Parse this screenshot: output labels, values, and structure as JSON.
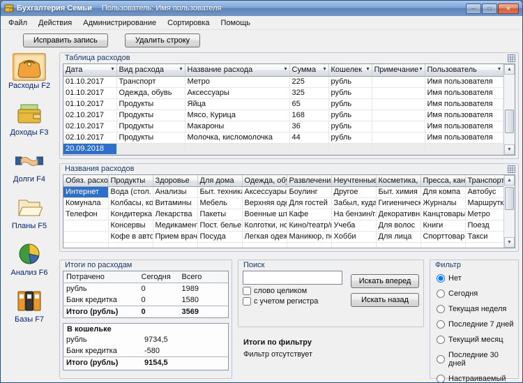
{
  "window": {
    "title": "Бухгалтерия Семьи",
    "user": "Пользователь: Имя пользователя",
    "controls": {
      "minimize": "─",
      "maximize": "□",
      "close": "✕"
    }
  },
  "menu": {
    "items": [
      {
        "label": "Файл"
      },
      {
        "label": "Действия"
      },
      {
        "label": "Администрирование"
      },
      {
        "label": "Сортировка"
      },
      {
        "label": "Помощь"
      }
    ]
  },
  "toolbar": {
    "buttons": [
      {
        "label": "Исправить запись"
      },
      {
        "label": "Удалить строку"
      }
    ]
  },
  "sidebar": {
    "items": [
      {
        "label": "Расходы F2",
        "selected": true
      },
      {
        "label": "Доходы F3",
        "selected": false
      },
      {
        "label": "Долги F4",
        "selected": false
      },
      {
        "label": "Планы F5",
        "selected": false
      },
      {
        "label": "Анализ F6",
        "selected": false
      },
      {
        "label": "Базы F7",
        "selected": false
      }
    ]
  },
  "expenses": {
    "group_title": "Таблица расходов",
    "columns": [
      "Дата",
      "Вид расхода",
      "Название расхода",
      "Сумма",
      "Кошелек",
      "Примечание",
      "Пользователь"
    ],
    "rows": [
      [
        "01.10.2017",
        "Транспорт",
        "Метро",
        "225",
        "рубль",
        "",
        "Имя пользователя"
      ],
      [
        "01.10.2017",
        "Одежда, обувь",
        "Аксессуары",
        "325",
        "рубль",
        "",
        "Имя пользователя"
      ],
      [
        "01.10.2017",
        "Продукты",
        "Яйца",
        "65",
        "рубль",
        "",
        "Имя пользователя"
      ],
      [
        "02.10.2017",
        "Продукты",
        "Мясо, Курица",
        "168",
        "рубль",
        "",
        "Имя пользователя"
      ],
      [
        "02.10.2017",
        "Продукты",
        "Макароны",
        "36",
        "рубль",
        "",
        "Имя пользователя"
      ],
      [
        "02.10.2017",
        "Продукты",
        "Молочка, кисломолочка",
        "44",
        "рубль",
        "",
        "Имя пользователя"
      ]
    ],
    "new_row_date": "20.09.2018"
  },
  "names": {
    "group_title": "Названия расходов",
    "columns": [
      "Обяз. расходы",
      "Продукты",
      "Здоровье",
      "Для дома",
      "Одежда, обувь",
      "Развлечения, к",
      "Неучтенные ра",
      "Косметика, бы",
      "Пресса, канцт",
      "Транспорт"
    ],
    "rows": [
      [
        "Интернет",
        "Вода (стол. и",
        "Анализы",
        "Быт. техника",
        "Аксессуары",
        "Боулинг",
        "Другое",
        "Быт. химия",
        "Для компа",
        "Автобус"
      ],
      [
        "Комунала",
        "Колбасы, копче",
        "Витамины",
        "Мебель",
        "Верхняя одежда",
        "Для гостей",
        "Забыл, куда пот",
        "Гигиенические",
        "Журналы",
        "Маршрутка"
      ],
      [
        "Телефон",
        "Кондитерка, кон",
        "Лекарства",
        "Пакеты",
        "Военные штуки",
        "Кафе",
        "На бензин/газ",
        "Декоративная в",
        "Канцтовары",
        "Метро"
      ],
      [
        "",
        "Консервы",
        "Медикаменты",
        "Пост. белье",
        "Колготки, носки",
        "Кино/театр/кон",
        "Учеба",
        "Для волос",
        "Книги",
        "Поезд"
      ],
      [
        "",
        "Кофе в автомат",
        "Прием врача",
        "Посуда",
        "Легкая одежда",
        "Маникюр, педи",
        "Хобби",
        "Для лица",
        "Спорттовары",
        "Такси"
      ]
    ]
  },
  "totals": {
    "group_title": "Итоги по расходам",
    "spent_columns": [
      "Потрачено",
      "Сегодня",
      "Всего"
    ],
    "spent_rows": [
      [
        "рубль",
        "0",
        "1989"
      ],
      [
        "Банк кредитка",
        "0",
        "1580"
      ],
      [
        "Итого (рубль)",
        "0",
        "3569"
      ]
    ],
    "wallet_title": "В кошельке",
    "wallet_rows": [
      [
        "рубль",
        "9734,5"
      ],
      [
        "Банк кредитка",
        "-580"
      ],
      [
        "Итого (рубль)",
        "9154,5"
      ]
    ]
  },
  "search": {
    "group_title": "Поиск",
    "input_value": "",
    "checkboxes": [
      {
        "label": "слово целиком",
        "checked": false
      },
      {
        "label": "с учетом регистра",
        "checked": false
      }
    ],
    "buttons": [
      {
        "label": "Искать вперед"
      },
      {
        "label": "Искать назад"
      }
    ],
    "filter_totals_title": "Итоги по фильтру",
    "filter_totals_text": "Фильтр отсутствует"
  },
  "filter": {
    "group_title": "Фильтр",
    "options": [
      {
        "label": "Нет",
        "selected": true
      },
      {
        "label": "Сегодня",
        "selected": false
      },
      {
        "label": "Текущая неделя",
        "selected": false
      },
      {
        "label": "Последние 7 дней",
        "selected": false
      },
      {
        "label": "Текущий месяц",
        "selected": false
      },
      {
        "label": "Последние 30 дней",
        "selected": false
      },
      {
        "label": "Настраиваемый",
        "selected": false
      }
    ]
  }
}
